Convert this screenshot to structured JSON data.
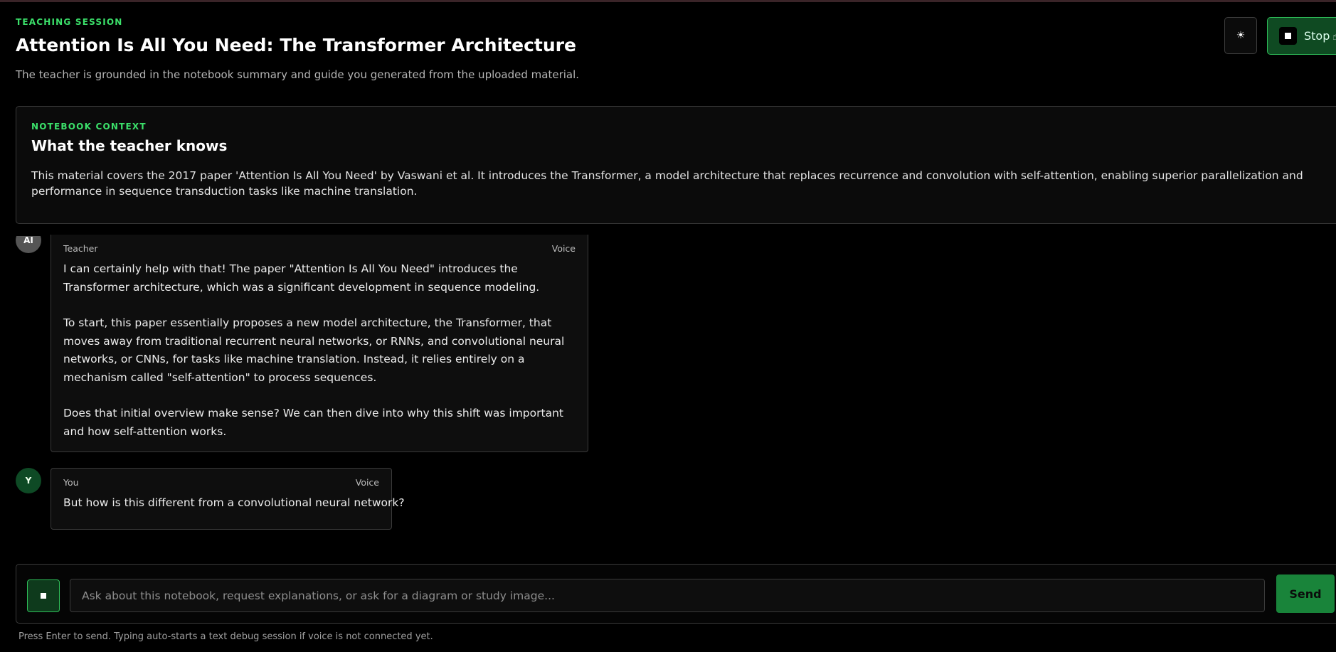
{
  "header": {
    "eyebrow": "TEACHING SESSION",
    "title": "Attention Is All You Need: The Transformer Architecture",
    "subtitle": "The teacher is grounded in the notebook summary and guide you generated from the uploaded material.",
    "theme_icon": "sun-icon",
    "stop_label": "Stop",
    "stop_icon": "stop-square-icon"
  },
  "context": {
    "eyebrow": "NOTEBOOK CONTEXT",
    "title": "What the teacher knows",
    "body": "This material covers the 2017 paper 'Attention Is All You Need' by Vaswani et al. It introduces the Transformer, a model architecture that replaces recurrence and convolution with self-attention, enabling superior parallelization and performance in sequence transduction tasks like machine translation."
  },
  "messages": [
    {
      "avatar": "AI",
      "role": "Teacher",
      "mode": "Voice",
      "paragraphs": [
        "I can certainly help with that! The paper \"Attention Is All You Need\" introduces the Transformer architecture, which was a significant development in sequence modeling.",
        "To start, this paper essentially proposes a new model architecture, the Transformer, that moves away from traditional recurrent neural networks, or RNNs, and convolutional neural networks, or CNNs, for tasks like machine translation. Instead, it relies entirely on a mechanism called \"self-attention\" to process sequences.",
        "Does that initial overview make sense? We can then dive into why this shift was important and how self-attention works."
      ]
    },
    {
      "avatar": "Y",
      "role": "You",
      "mode": "Voice",
      "paragraphs": [
        "But how is this different from a convolutional neural network?"
      ]
    }
  ],
  "composer": {
    "placeholder": "Ask about this notebook, request explanations, or ask for a diagram or study image...",
    "value": "",
    "send_label": "Send",
    "hint": "Press Enter to send. Typing auto-starts a text debug session if voice is not connected yet."
  },
  "colors": {
    "accent": "#3be06a",
    "button_green": "#19843a",
    "background": "#000000"
  }
}
